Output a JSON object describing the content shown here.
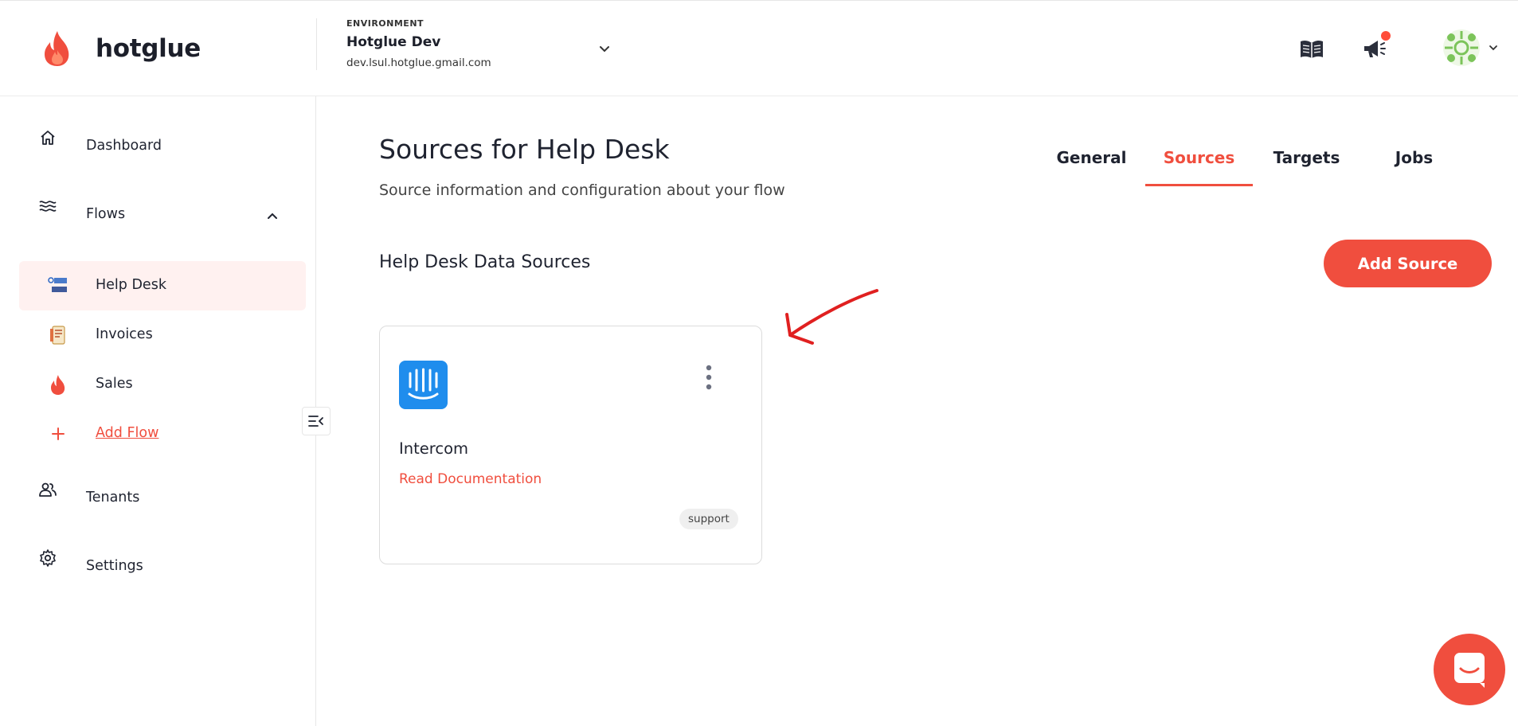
{
  "brand": {
    "name": "hotglue",
    "accent_color": "#f04e3e"
  },
  "environment": {
    "caption": "ENVIRONMENT",
    "name": "Hotglue Dev",
    "email": "dev.lsul.hotglue.gmail.com"
  },
  "header_icons": [
    "book-icon",
    "megaphone-icon",
    "chevron-down-icon"
  ],
  "sidebar": {
    "items": [
      {
        "label": "Dashboard",
        "icon": "home-icon"
      },
      {
        "label": "Flows",
        "icon": "waves-icon",
        "expanded": true
      },
      {
        "label": "Tenants",
        "icon": "users-icon"
      },
      {
        "label": "Settings",
        "icon": "gear-icon"
      }
    ],
    "flows": [
      {
        "label": "Help Desk",
        "icon": "help-desk-logo-icon",
        "active": true
      },
      {
        "label": "Invoices",
        "icon": "invoice-icon"
      },
      {
        "label": "Sales",
        "icon": "flame-icon"
      },
      {
        "label": "Add Flow",
        "icon": "plus-icon"
      }
    ]
  },
  "main": {
    "title": "Sources for Help Desk",
    "subtitle": "Source information and configuration about your flow",
    "tabs": [
      {
        "label": "General",
        "active": false
      },
      {
        "label": "Sources",
        "active": true
      },
      {
        "label": "Targets",
        "active": false
      },
      {
        "label": "Jobs",
        "active": false
      }
    ],
    "section_title": "Help Desk Data Sources",
    "add_source_label": "Add Source",
    "sources": [
      {
        "name": "Intercom",
        "doc_link": "Read Documentation",
        "tag": "support",
        "logo_color": "#1f8ded"
      }
    ]
  }
}
